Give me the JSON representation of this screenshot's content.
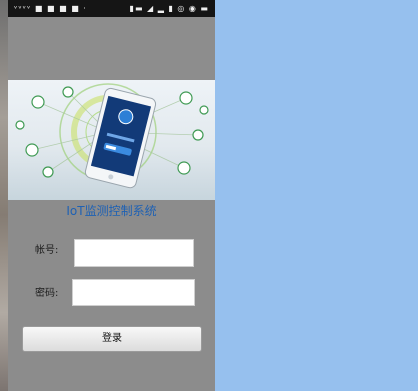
{
  "status_bar": {
    "left_indicators": "ᵛᵛᵛᵛ ■ ■ ■ ■ ·",
    "right_indicators": "▮▬ ◢ ▂ ▮ ◎ ◉ ▬"
  },
  "app": {
    "title": "IoT监测控制系统"
  },
  "form": {
    "account_label": "帐号:",
    "account_value": "",
    "password_label": "密码:",
    "password_value": "",
    "login_button": "登录"
  },
  "colors": {
    "accent": "#1e61b4",
    "background_panel": "#96c0ee",
    "phone_body": "#8c8c8c"
  }
}
